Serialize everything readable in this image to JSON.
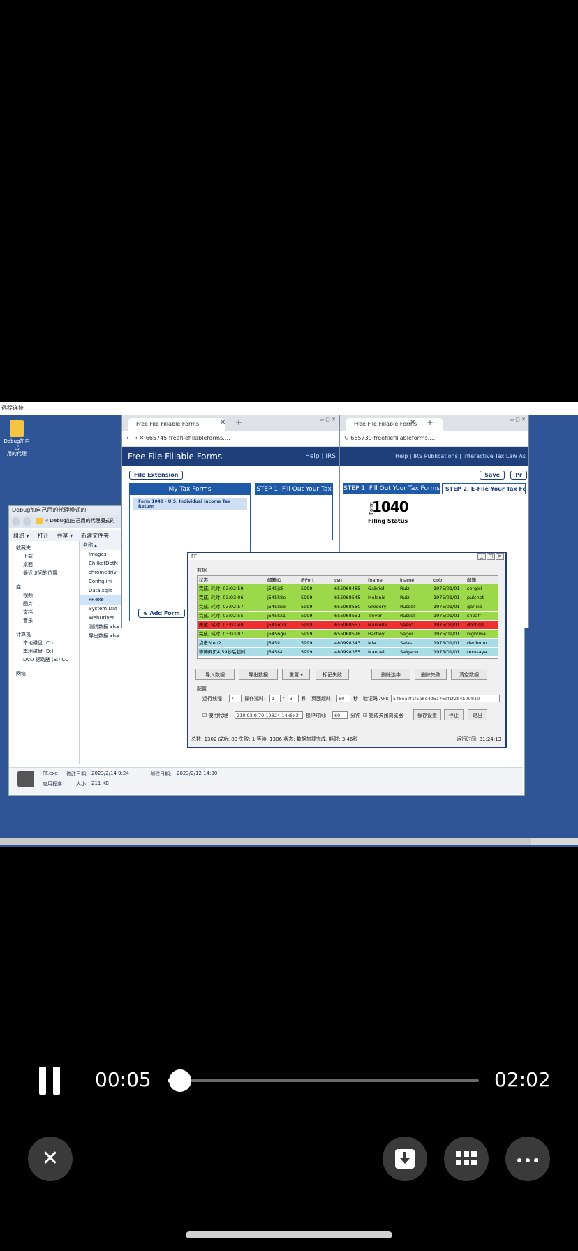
{
  "video": {
    "title_bar": "远程连接",
    "desktop_icon_label": "Debug加自己\n用的代理",
    "explorer": {
      "title": "Debug加自己用的代理模式的",
      "address": "« Debug加自己用的代理模式的",
      "toolbar": [
        "组织 ▾",
        "打开",
        "共享 ▾",
        "新建文件夹"
      ],
      "nav": [
        "收藏夹",
        "下载",
        "桌面",
        "最近访问的位置",
        "库",
        "视频",
        "图片",
        "文档",
        "音乐",
        "计算机",
        "本地磁盘 (C:)",
        "本地磁盘 (D:)",
        "DVD 驱动器 (E:) CC",
        "网络"
      ],
      "files_header": "名称 ▴",
      "files": [
        "Images",
        "ChilkatDotN",
        "chromedriv",
        "Config.ini",
        "Data.sqlit",
        "FF.exe",
        "System.Dat",
        "WebDriver.",
        "测试数据.xlsx",
        "导出数据.xlsx"
      ],
      "status": {
        "name": "FF.exe",
        "modified_label": "修改日期:",
        "modified": "2023/2/14 9:24",
        "created_label": "创建日期:",
        "created": "2023/2/12 14:30",
        "type": "应用程序",
        "size_label": "大小:",
        "size": "211 KB"
      }
    },
    "browser_left": {
      "tab": "Free File Fillable Forms",
      "address": "665745  freefilefillableforms.…",
      "site_title": "Free File Fillable Forms",
      "links": [
        "Help",
        "IRS"
      ],
      "file_extension_btn": "File Extension",
      "panel_my_forms": "My Tax Forms",
      "form_item": "Form 1040 - U.S. Individual Income Tax Return",
      "panel_step1": "STEP 1. Fill Out Your Tax",
      "add_form_btn": "Add Form"
    },
    "browser_right": {
      "tab": "Free File Fillable Forms",
      "address": "665739  freefilefillableforms.…",
      "links": [
        "Help",
        "IRS Publications",
        "Interactive Tax Law As"
      ],
      "save_btn": "Save",
      "print_btn": "Pr",
      "tab_step1": "STEP 1. Fill Out Your Tax Forms",
      "tab_step2": "STEP 2. E-File Your Tax Fo",
      "form_number": "1040",
      "form_label": "Form",
      "filing_status": "Filing Status"
    },
    "ff_app": {
      "title": "FF",
      "group_data": "数据",
      "columns": [
        "状态",
        "邮箱ID",
        "IPPort",
        "ssn",
        "fname",
        "lname",
        "dob",
        "邮箱"
      ],
      "rows": [
        {
          "status": "完成, 耗时: 03:02:59",
          "id": "j545jc5",
          "port": "5999",
          "ssn": "655068485",
          "fname": "Gabriel",
          "lname": "Ruiz",
          "dob": "1975/01/01",
          "mail": "sergiol",
          "color": "#9bd84a"
        },
        {
          "status": "完成, 耗时: 03:03:06",
          "id": "j545k8e",
          "port": "5999",
          "ssn": "655068545",
          "fname": "Melanie",
          "lname": "Ruiz",
          "dob": "1975/01/01",
          "mail": "pulchet",
          "color": "#9bd84a"
        },
        {
          "status": "完成, 耗时: 03:02:57",
          "id": "j545kub",
          "port": "5999",
          "ssn": "655068550",
          "fname": "Gregory",
          "lname": "Russell",
          "dob": "1975/01/01",
          "mail": "garisio",
          "color": "#9bd84a"
        },
        {
          "status": "完成, 耗时: 03:02:55",
          "id": "j545kx1",
          "port": "5999",
          "ssn": "655068551",
          "fname": "Trevor",
          "lname": "Russell",
          "dob": "1975/01/01",
          "mail": "sheaff",
          "color": "#9bd84a"
        },
        {
          "status": "失败, 耗时: 03:02:40",
          "id": "j545mck",
          "port": "5999",
          "ssn": "655068557",
          "fname": "Marcella",
          "lname": "Saenz",
          "dob": "1975/01/01",
          "mail": "dochsle",
          "color": "#ee3030"
        },
        {
          "status": "完成, 耗时: 03:03:07",
          "id": "j545ngv",
          "port": "5999",
          "ssn": "655068578",
          "fname": "Hartley",
          "lname": "Sager",
          "dob": "1975/01/01",
          "mail": "nightma",
          "color": "#9bd84a"
        },
        {
          "status": "点击Step2",
          "id": "j545ir",
          "port": "5999",
          "ssn": "480998343",
          "fname": "Mia",
          "lname": "Salas",
          "dob": "1975/01/01",
          "mail": "denbonn",
          "color": "#a8dde8"
        },
        {
          "status": "等待网页4,59秒后超时",
          "id": "j545ist",
          "port": "5999",
          "ssn": "480998355",
          "fname": "Manuel",
          "lname": "Salgado",
          "dob": "1975/01/01",
          "mail": "terusaya",
          "color": "#a8dde8"
        }
      ],
      "buttons": [
        "导入数据",
        "导出数据",
        "重置 ▾",
        "标记失败",
        "删除选中",
        "删除失败",
        "清空数据"
      ],
      "group_settings": "配置",
      "settings": {
        "threads_label": "运行线程:",
        "threads": "7",
        "delay_label": "操作延时:",
        "delay_min": "1",
        "delay_sep": "-",
        "delay_max": "3",
        "sec": "秒",
        "page_timeout_label": "页面超时:",
        "page_timeout": "60",
        "captcha_label": "验证码 API:",
        "captcha_key": "545ea7f1f5a6e495176ef1f2b4500810",
        "proxy_label": "使用代理",
        "proxy_value": "218.93.9.79:12324:14x8x3",
        "switch_label": "换IP时间:",
        "switch_value": "60",
        "minutes": "分钟",
        "close_browser_label": "完成关闭浏览器",
        "save_btn": "保存设置",
        "stop_btn": "停止",
        "exit_btn": "退出"
      },
      "statusbar": "总数: 1302  成功: 80  失败: 1  等待: 1306  状态: 数据加载完成, 耗时: 3.46秒",
      "runtime": "运行时间: 01:24:13"
    }
  },
  "player": {
    "current_time": "00:05",
    "total_time": "02:02",
    "progress": 0.041
  },
  "colors": {
    "background": "#000000",
    "desktop": "#2f5597",
    "accent_blue": "#1f3f7a"
  }
}
